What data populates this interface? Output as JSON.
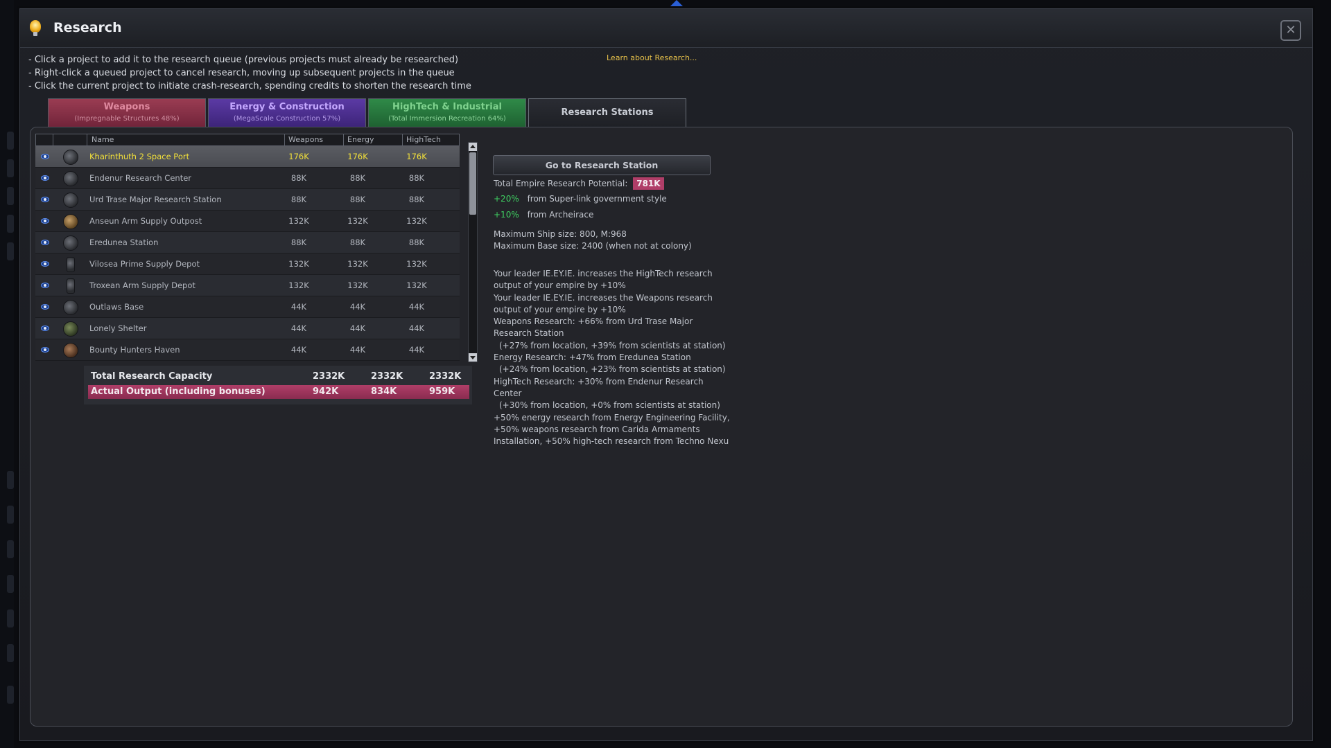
{
  "window": {
    "title": "Research",
    "close_glyph": "✕",
    "icon": "lightbulb-icon"
  },
  "instructions": [
    "- Click a project to add it to the research queue (previous projects must already be researched)",
    "- Right-click a queued project to cancel research, moving up subsequent projects in the queue",
    "- Click the current project to initiate crash-research, spending credits to shorten the research time"
  ],
  "learn_link": "Learn about Research...",
  "tabs": [
    {
      "label": "Weapons",
      "sub": "(Impregnable Structures 48%)"
    },
    {
      "label": "Energy & Construction",
      "sub": "(MegaScale Construction 57%)"
    },
    {
      "label": "HighTech & Industrial",
      "sub": "(Total Immersion Recreation 64%)"
    },
    {
      "label": "Research Stations",
      "sub": ""
    }
  ],
  "table": {
    "columns": [
      "Name",
      "Weapons",
      "Energy",
      "HighTech"
    ],
    "rows": [
      {
        "name": "Kharinthuth 2 Space Port",
        "weapons": "176K",
        "energy": "176K",
        "hightech": "176K",
        "icon": "space-port-icon"
      },
      {
        "name": "Endenur Research Center",
        "weapons": "88K",
        "energy": "88K",
        "hightech": "88K",
        "icon": "research-center-icon"
      },
      {
        "name": "Urd Trase Major Research Station",
        "weapons": "88K",
        "energy": "88K",
        "hightech": "88K",
        "icon": "research-station-icon"
      },
      {
        "name": "Anseun Arm Supply Outpost",
        "weapons": "132K",
        "energy": "132K",
        "hightech": "132K",
        "icon": "supply-outpost-icon"
      },
      {
        "name": "Eredunea Station",
        "weapons": "88K",
        "energy": "88K",
        "hightech": "88K",
        "icon": "station-icon"
      },
      {
        "name": "Vilosea Prime Supply Depot",
        "weapons": "132K",
        "energy": "132K",
        "hightech": "132K",
        "icon": "supply-depot-icon"
      },
      {
        "name": "Troxean Arm Supply Depot",
        "weapons": "132K",
        "energy": "132K",
        "hightech": "132K",
        "icon": "supply-depot-icon"
      },
      {
        "name": "Outlaws Base",
        "weapons": "44K",
        "energy": "44K",
        "hightech": "44K",
        "icon": "base-icon"
      },
      {
        "name": "Lonely Shelter",
        "weapons": "44K",
        "energy": "44K",
        "hightech": "44K",
        "icon": "shelter-icon"
      },
      {
        "name": "Bounty Hunters Haven",
        "weapons": "44K",
        "energy": "44K",
        "hightech": "44K",
        "icon": "haven-icon"
      }
    ],
    "totals": {
      "capacity": {
        "label": "Total Research Capacity",
        "weapons": "2332K",
        "energy": "2332K",
        "hightech": "2332K"
      },
      "output": {
        "label": "Actual Output (including bonuses)",
        "weapons": "942K",
        "energy": "834K",
        "hightech": "959K"
      }
    }
  },
  "info": {
    "goto_button": "Go to Research Station",
    "potential_label": "Total Empire Research Potential:",
    "potential_value": "781K",
    "bonuses": [
      {
        "value": "+20%",
        "text": "from Super-link government style"
      },
      {
        "value": "+10%",
        "text": "from Archeirace"
      }
    ],
    "ship_size": "Maximum Ship size: 800, M:968",
    "base_size": "Maximum Base size: 2400 (when not at colony)",
    "details": [
      "Your leader IE.EY.IE. increases the HighTech research",
      "output of your empire by +10%",
      "Your leader IE.EY.IE. increases the Weapons research",
      "output of your empire by +10%",
      "Weapons Research: +66% from Urd Trase Major",
      "Research Station",
      "(+27% from location, +39% from scientists at station)",
      "Energy Research: +47% from Eredunea Station",
      "(+24% from location, +23% from scientists at station)",
      "HighTech Research: +30% from Endenur Research",
      "Center",
      "(+30% from location, +0% from scientists at station)",
      "+50% energy research from Energy Engineering Facility,",
      "+50% weapons research from Carida Armaments",
      "Installation, +50% high-tech research from Techno Nexu"
    ]
  },
  "colors": {
    "selected_text": "#f2e03a",
    "output_bar": "#b03e68",
    "bonus_green": "#3fd162",
    "weapons_tab": "#9a3c52",
    "energy_tab": "#5b3aa4",
    "hightech_tab": "#2f8a48"
  }
}
